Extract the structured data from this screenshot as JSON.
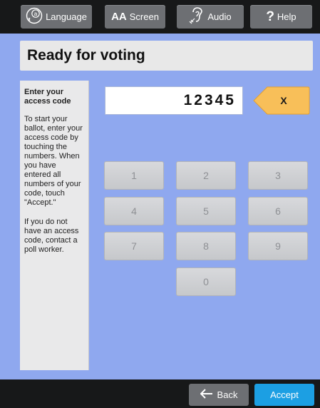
{
  "toolbar": {
    "language_label": "Language",
    "screen_prefix": "AA",
    "screen_label": "Screen",
    "audio_label": "Audio",
    "help_label": "Help"
  },
  "main": {
    "title": "Ready for voting",
    "side": {
      "heading": "Enter your access code",
      "para1": "To start your ballot, enter your access code by touching the numbers.  When you have entered all numbers of your code, touch \"Accept.\"",
      "para2": "If you do not have an access code, contact a poll worker."
    },
    "code_value": "12345",
    "clear_label": "X",
    "keys": [
      "1",
      "2",
      "3",
      "4",
      "5",
      "6",
      "7",
      "8",
      "9",
      "0"
    ]
  },
  "bottom": {
    "back_label": "Back",
    "accept_label": "Accept"
  },
  "colors": {
    "background": "#8fa8ef",
    "toolbar": "#171819",
    "accept": "#1c9fe3",
    "clear": "#f8bf59"
  }
}
